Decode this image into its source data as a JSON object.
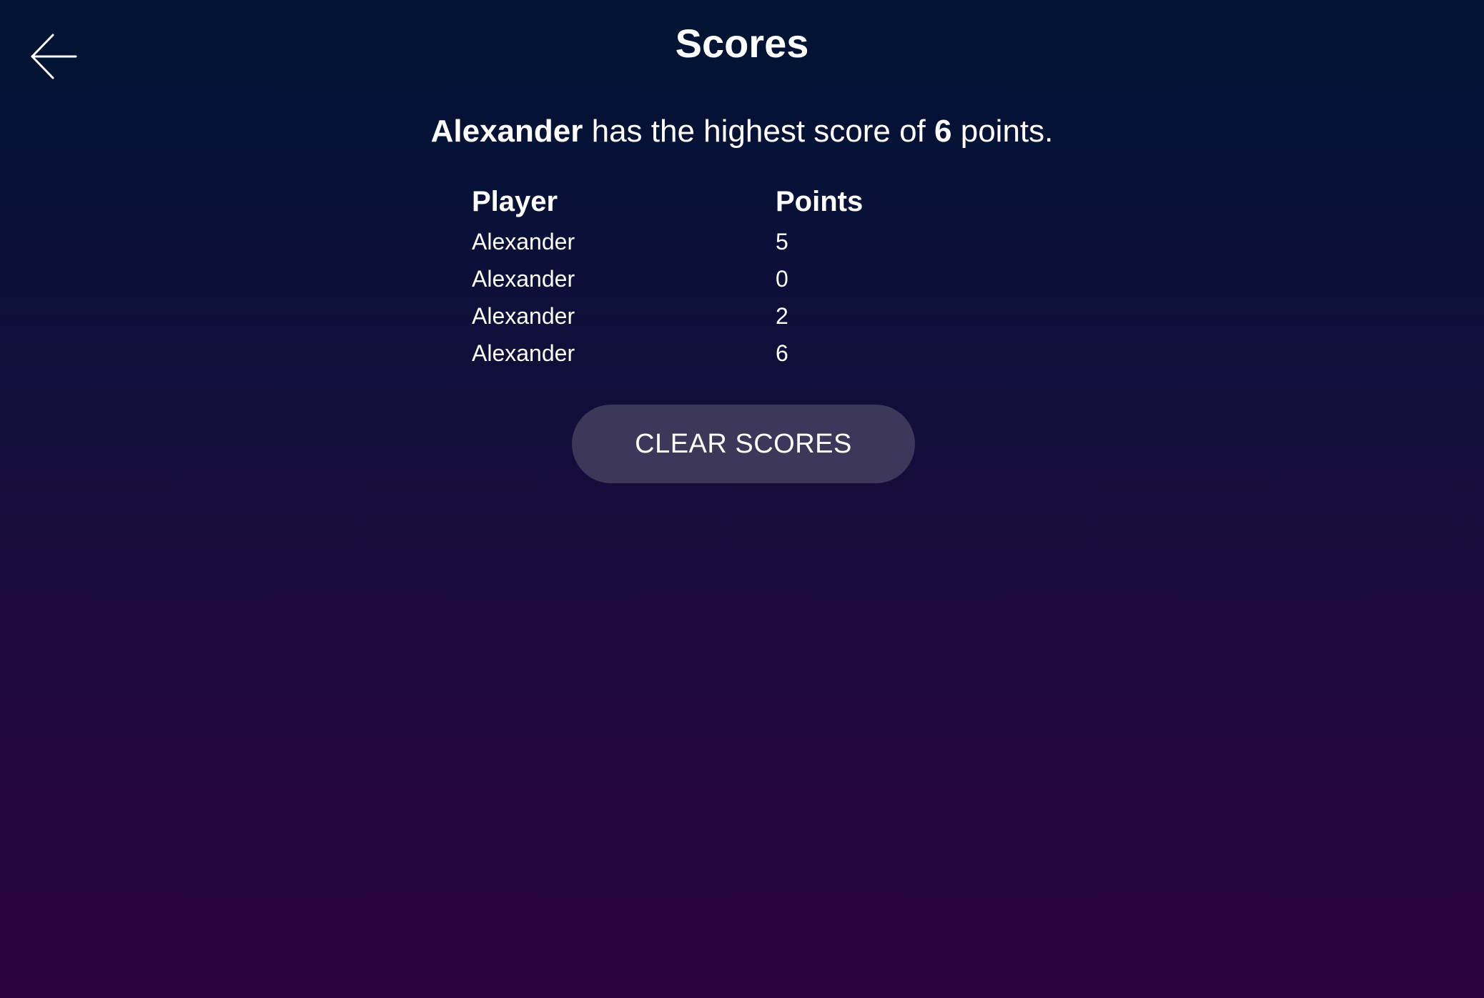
{
  "header": {
    "title": "Scores",
    "back_icon": "arrow-left-icon"
  },
  "summary": {
    "leader_name": "Alexander",
    "middle_text": " has the highest score of ",
    "high_score": "6",
    "end_text": " points."
  },
  "table": {
    "headers": [
      "Player",
      "Points"
    ],
    "rows": [
      {
        "player": "Alexander",
        "points": "5"
      },
      {
        "player": "Alexander",
        "points": "0"
      },
      {
        "player": "Alexander",
        "points": "2"
      },
      {
        "player": "Alexander",
        "points": "6"
      }
    ]
  },
  "actions": {
    "clear_label": "CLEAR SCORES"
  },
  "colors": {
    "background_top": "#001433",
    "background_bottom": "#2b003f",
    "button_bg": "#3d3759",
    "text": "#ffffff"
  }
}
